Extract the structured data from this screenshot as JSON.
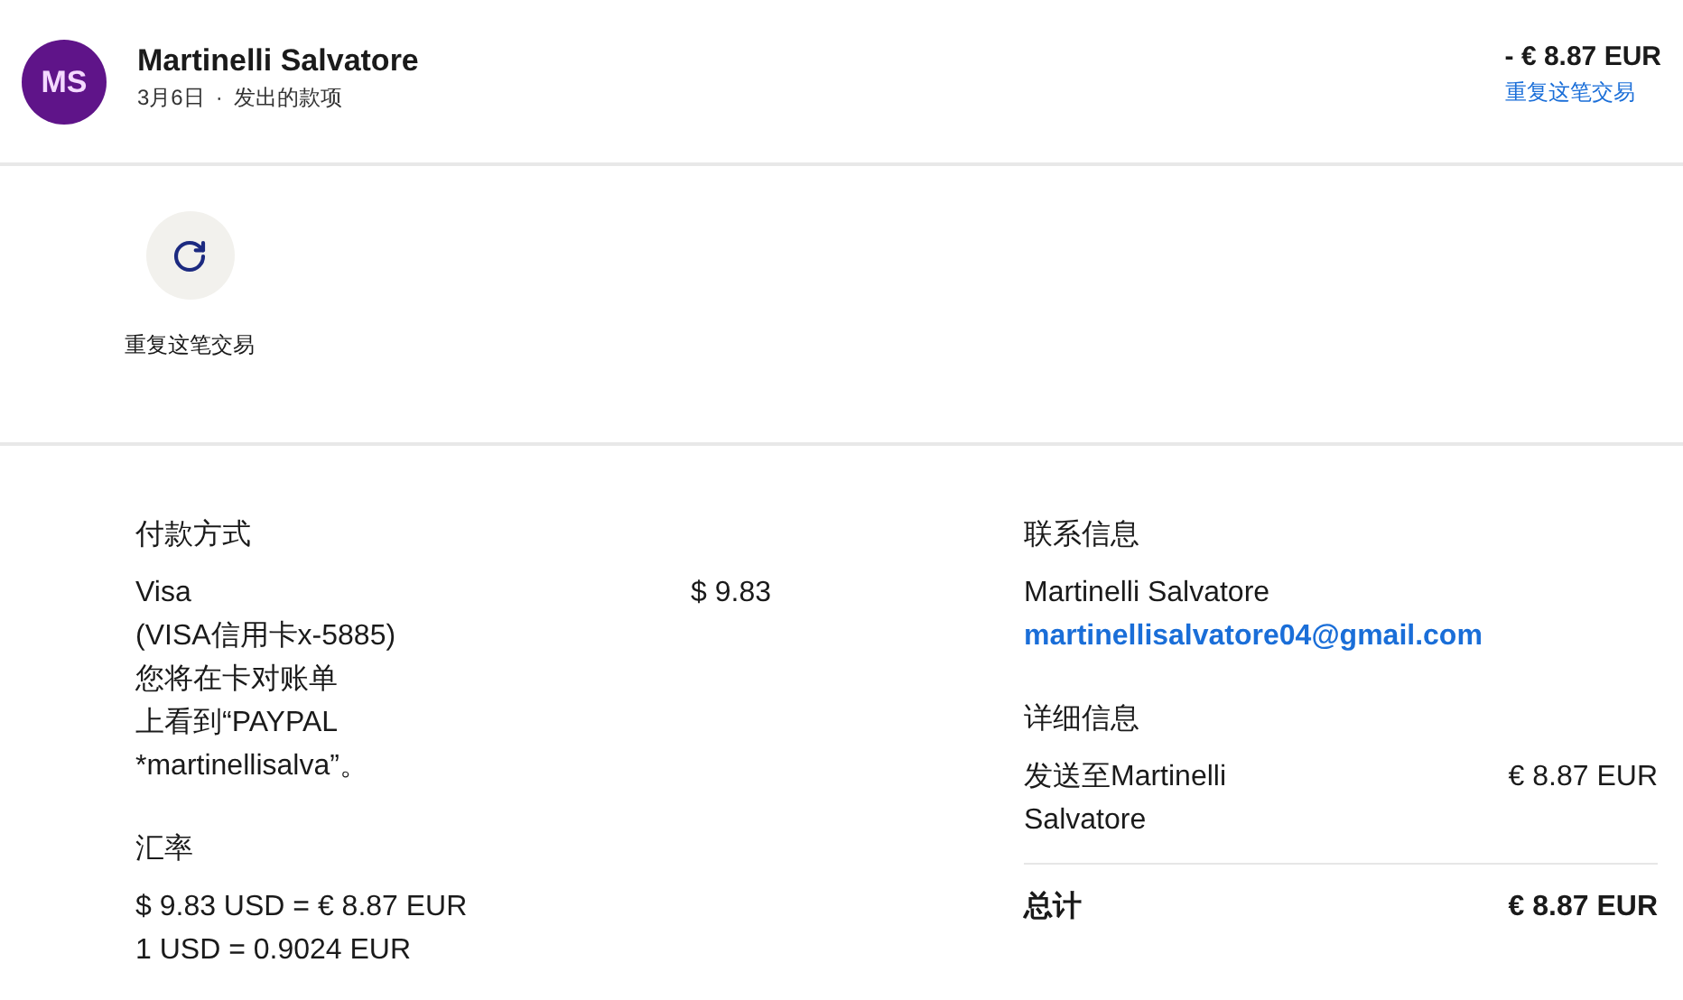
{
  "header": {
    "avatar_initials": "MS",
    "name": "Martinelli Salvatore",
    "date": "3月6日",
    "dot": "·",
    "type": "发出的款项",
    "amount": "- € 8.87 EUR",
    "repeat_link": "重复这笔交易"
  },
  "actions": [
    {
      "label": "重复这笔交易"
    }
  ],
  "payment": {
    "title": "付款方式",
    "lines": [
      "Visa",
      "(VISA信用卡x-5885)",
      "您将在卡对账单",
      "上看到“PAYPAL",
      "*martinellisalva”。"
    ],
    "amount": "$ 9.83"
  },
  "exchange": {
    "title": "汇率",
    "lines": [
      "$ 9.83 USD = € 8.87 EUR",
      "1 USD = 0.9024 EUR"
    ]
  },
  "contact": {
    "title": "联系信息",
    "name": "Martinelli Salvatore",
    "email": "martinellisalvatore04@gmail.com"
  },
  "details": {
    "title": "详细信息",
    "rows": [
      {
        "label": "发送至Martinelli Salvatore",
        "amount": "€ 8.87 EUR"
      }
    ],
    "total_label": "总计",
    "total_amount": "€ 8.87 EUR"
  }
}
